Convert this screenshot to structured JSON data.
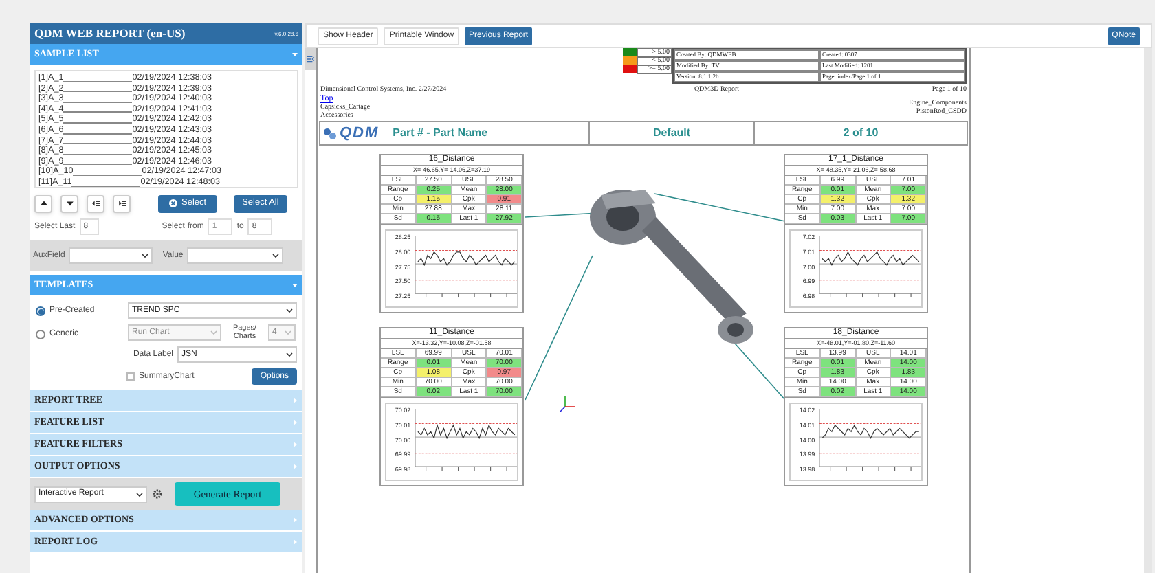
{
  "app_header": {
    "title": "QDM WEB REPORT (en-US)",
    "version": "v.6.0.28.6"
  },
  "sample_list": {
    "title": "SAMPLE LIST",
    "expanded": true,
    "items": [
      {
        "name": "[1]A_1",
        "date": "02/19/2024 12:38:03"
      },
      {
        "name": "[2]A_2",
        "date": "02/19/2024 12:39:03"
      },
      {
        "name": "[3]A_3",
        "date": "02/19/2024 12:40:03"
      },
      {
        "name": "[4]A_4",
        "date": "02/19/2024 12:41:03"
      },
      {
        "name": "[5]A_5",
        "date": "02/19/2024 12:42:03"
      },
      {
        "name": "[6]A_6",
        "date": "02/19/2024 12:43:03"
      },
      {
        "name": "[7]A_7",
        "date": "02/19/2024 12:44:03"
      },
      {
        "name": "[8]A_8",
        "date": "02/19/2024 12:45:03"
      },
      {
        "name": "[9]A_9",
        "date": "02/19/2024 12:46:03"
      },
      {
        "name": "[10]A_10",
        "date": "02/19/2024 12:47:03"
      },
      {
        "name": "[11]A_11",
        "date": "02/19/2024 12:48:03"
      }
    ],
    "select_button": "Select",
    "select_all_button": "Select All",
    "select_last_label": "Select Last",
    "select_last_value": "8",
    "select_from_label": "Select",
    "from_label": "from",
    "from_value": "1",
    "to_label": "to",
    "to_value": "8"
  },
  "filters": {
    "auxfield_label": "AuxField",
    "value_label": "Value"
  },
  "templates": {
    "title": "TEMPLATES",
    "expanded": true,
    "options": [
      {
        "label": "Pre-Created",
        "selected": true
      },
      {
        "label": "Generic",
        "selected": false
      }
    ],
    "template_value": "TREND SPC",
    "chart_type": {
      "value": "Run Chart",
      "disabled": true
    },
    "pages_label": "Pages/ Charts",
    "pages": {
      "value": "4",
      "disabled": true
    },
    "data_label_label": "Data Label",
    "data_label_value": "JSN",
    "summary_chart": {
      "label": "SummaryChart",
      "checked": false
    },
    "options_button": "Options"
  },
  "sections_top": [
    {
      "title": "REPORT TREE",
      "expanded": false
    },
    {
      "title": "FEATURE LIST",
      "expanded": false
    },
    {
      "title": "FEATURE FILTERS",
      "expanded": false
    },
    {
      "title": "OUTPUT OPTIONS",
      "expanded": false
    }
  ],
  "output": {
    "format": "Interactive Report",
    "generate_button": "Generate Report"
  },
  "sections_bottom": [
    {
      "title": "ADVANCED OPTIONS",
      "expanded": false
    },
    {
      "title": "REPORT LOG",
      "expanded": false
    }
  ],
  "toolbar": {
    "buttons": [
      {
        "label": "Show Header",
        "kind": "plain"
      },
      {
        "label": "Printable Window",
        "kind": "plain"
      },
      {
        "label": "Previous Report",
        "kind": "primary"
      }
    ],
    "qnote": "QNote"
  },
  "report": {
    "legend": [
      {
        "text": "> 5.00",
        "color": "#1a8a1a"
      },
      {
        "text": "< 5.00",
        "color": "#f59a1a"
      },
      {
        "text": ">= 5.00",
        "color": "#e01010"
      }
    ],
    "info": [
      [
        "Created By: QDMWEB",
        "Created: 0307"
      ],
      [
        "Modified By: TV",
        "Last Modified: 1201"
      ],
      [
        "Version: 8.1.1.2b",
        "Page: index/Page 1 of 1"
      ]
    ],
    "company": "Dimensional Control Systems, Inc. 2/27/2024",
    "report_name": "QDM3D Report",
    "page": "Page 1 of 10",
    "link": "Top",
    "path_left": [
      "Capsicks_Cartage",
      "Accessories"
    ],
    "path_right": [
      "Engine_Components",
      "PistonRod_CSDD"
    ],
    "banner": {
      "logo": "QDM",
      "part": "Part # - Part Name",
      "variant": "Default",
      "count": "2 of 10"
    },
    "cards": [
      {
        "title": "16_Distance",
        "coords": "X=-46.65,Y=-14.06,Z=37.19",
        "stats": [
          {
            "label": "LSL",
            "value": "27.50"
          },
          {
            "label": "USL",
            "value": "28.50"
          },
          {
            "label": "Range",
            "value": "0.25",
            "color": "#7ee27e"
          },
          {
            "label": "Mean",
            "value": "28.00",
            "color": "#7ee27e"
          },
          {
            "label": "Cp",
            "value": "1.15",
            "color": "#f4f06a"
          },
          {
            "label": "Cpk",
            "value": "0.91",
            "color": "#f28a8a"
          },
          {
            "label": "Min",
            "value": "27.88"
          },
          {
            "label": "Max",
            "value": "28.11"
          },
          {
            "label": "Sd",
            "value": "0.15",
            "color": "#7ee27e"
          },
          {
            "label": "Last 1",
            "value": "27.92",
            "color": "#7ee27e"
          }
        ],
        "yticks": [
          "28.25",
          "28.00",
          "27.75",
          "27.50",
          "27.25"
        ]
      },
      {
        "title": "11_Distance",
        "coords": "X=-13.32,Y=-10.08,Z=-01.58",
        "stats": [
          {
            "label": "LSL",
            "value": "69.99"
          },
          {
            "label": "USL",
            "value": "70.01"
          },
          {
            "label": "Range",
            "value": "0.01",
            "color": "#7ee27e"
          },
          {
            "label": "Mean",
            "value": "70.00",
            "color": "#7ee27e"
          },
          {
            "label": "Cp",
            "value": "1.08",
            "color": "#f4f06a"
          },
          {
            "label": "Cpk",
            "value": "0.97",
            "color": "#f28a8a"
          },
          {
            "label": "Min",
            "value": "70.00"
          },
          {
            "label": "Max",
            "value": "70.00"
          },
          {
            "label": "Sd",
            "value": "0.02",
            "color": "#7ee27e"
          },
          {
            "label": "Last 1",
            "value": "70.00",
            "color": "#7ee27e"
          }
        ],
        "yticks": [
          "70.02",
          "70.01",
          "70.00",
          "69.99",
          "69.98"
        ]
      },
      {
        "title": "17_1_Distance",
        "coords": "X=-48.35,Y=-21.06,Z=-58.68",
        "stats": [
          {
            "label": "LSL",
            "value": "6.99"
          },
          {
            "label": "USL",
            "value": "7.01"
          },
          {
            "label": "Range",
            "value": "0.01",
            "color": "#7ee27e"
          },
          {
            "label": "Mean",
            "value": "7.00",
            "color": "#7ee27e"
          },
          {
            "label": "Cp",
            "value": "1.32",
            "color": "#f4f06a"
          },
          {
            "label": "Cpk",
            "value": "1.32",
            "color": "#f4f06a"
          },
          {
            "label": "Min",
            "value": "7.00"
          },
          {
            "label": "Max",
            "value": "7.00"
          },
          {
            "label": "Sd",
            "value": "0.03",
            "color": "#7ee27e"
          },
          {
            "label": "Last 1",
            "value": "7.00",
            "color": "#7ee27e"
          }
        ],
        "yticks": [
          "7.02",
          "7.01",
          "7.00",
          "6.99",
          "6.98"
        ]
      },
      {
        "title": "18_Distance",
        "coords": "X=-48.01,Y=-01.80,Z=-11.60",
        "stats": [
          {
            "label": "LSL",
            "value": "13.99"
          },
          {
            "label": "USL",
            "value": "14.01"
          },
          {
            "label": "Range",
            "value": "0.01",
            "color": "#7ee27e"
          },
          {
            "label": "Mean",
            "value": "14.00",
            "color": "#7ee27e"
          },
          {
            "label": "Cp",
            "value": "1.83",
            "color": "#7ee27e"
          },
          {
            "label": "Cpk",
            "value": "1.83",
            "color": "#7ee27e"
          },
          {
            "label": "Min",
            "value": "14.00"
          },
          {
            "label": "Max",
            "value": "14.00"
          },
          {
            "label": "Sd",
            "value": "0.02",
            "color": "#7ee27e"
          },
          {
            "label": "Last 1",
            "value": "14.00",
            "color": "#7ee27e"
          }
        ],
        "yticks": [
          "14.02",
          "14.01",
          "14.00",
          "13.99",
          "13.98"
        ]
      }
    ]
  }
}
